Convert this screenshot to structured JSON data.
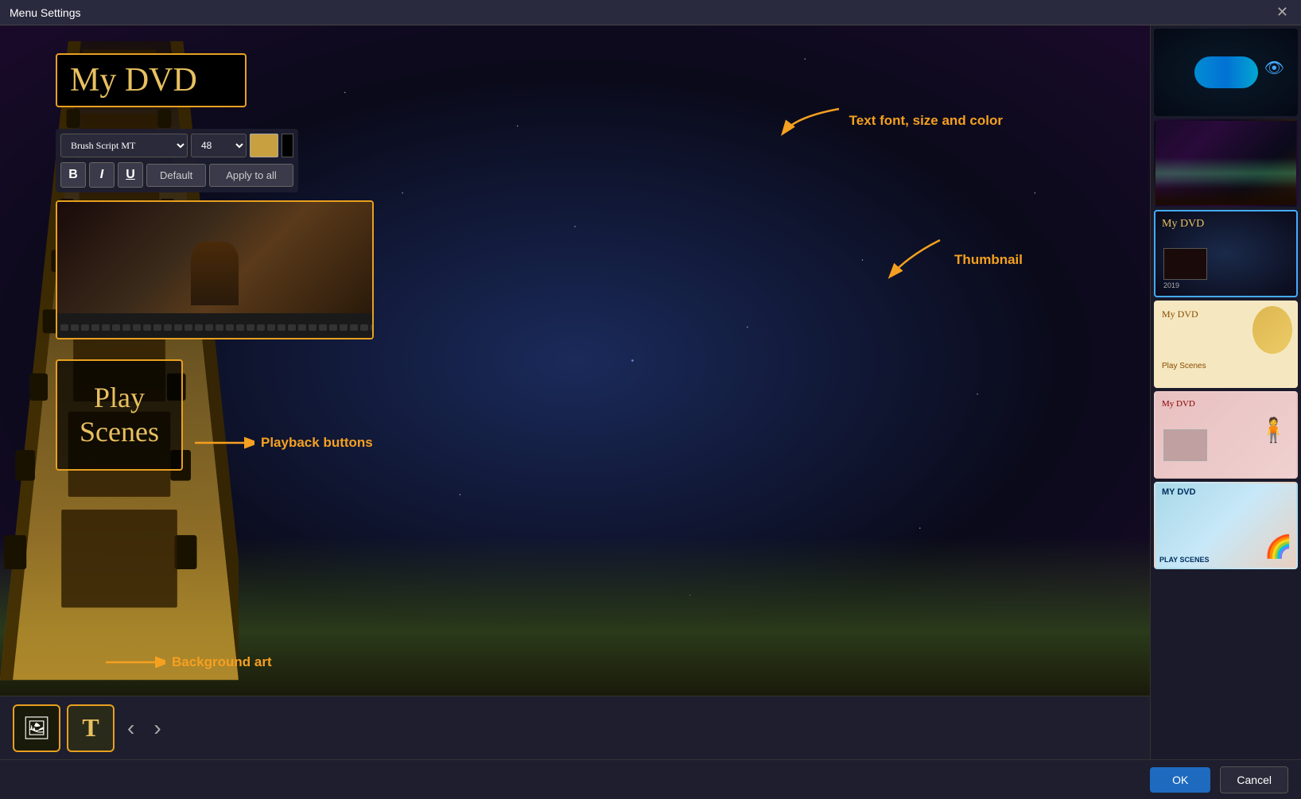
{
  "window": {
    "title": "Menu Settings",
    "close_label": "✕"
  },
  "titlebox": {
    "title_text": "My DVD"
  },
  "font_controls": {
    "font_name": "Brush Script MT",
    "font_size": "48",
    "bold_label": "B",
    "italic_label": "I",
    "underline_label": "U",
    "default_label": "Default",
    "apply_all_label": "Apply to all"
  },
  "annotations": {
    "text_font": "Text font, size and color",
    "thumbnail": "Thumbnail",
    "playback": "Playback buttons",
    "background": "Background art"
  },
  "playback": {
    "text": "Play\nScenes"
  },
  "toolbar": {
    "image_icon": "🖼",
    "text_icon": "T",
    "prev_label": "‹",
    "next_label": "›"
  },
  "templates": [
    {
      "id": "thumb-1",
      "type": "dark-space",
      "active": false
    },
    {
      "id": "thumb-2",
      "type": "aurora",
      "active": false
    },
    {
      "id": "thumb-3",
      "type": "my-dvd-film",
      "active": true
    },
    {
      "id": "thumb-4",
      "type": "vintage",
      "active": false
    },
    {
      "id": "thumb-5",
      "type": "romantic",
      "active": false
    },
    {
      "id": "thumb-6",
      "type": "kids",
      "active": false
    }
  ],
  "actions": {
    "ok_label": "OK",
    "cancel_label": "Cancel"
  }
}
